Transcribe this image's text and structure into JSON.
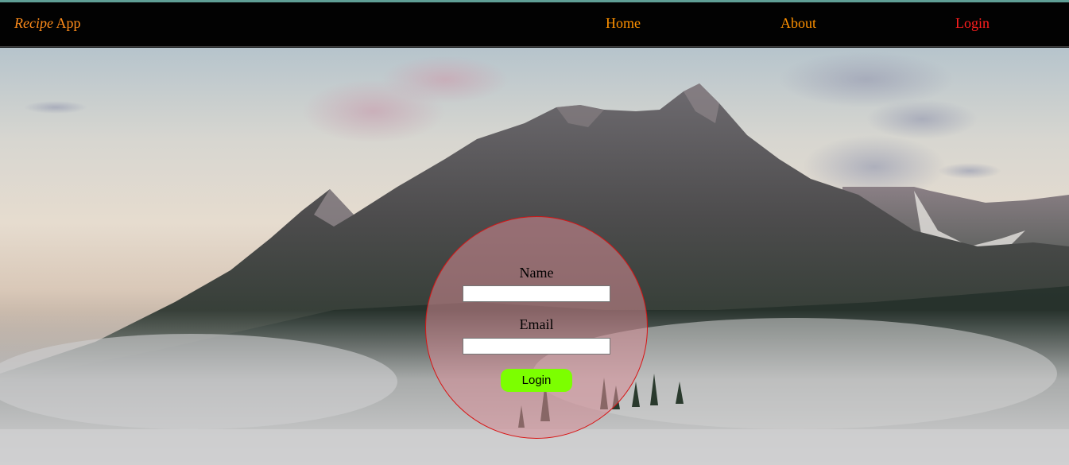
{
  "brand": {
    "italic": "Recipe",
    "rest": " App"
  },
  "nav": {
    "home": "Home",
    "about": "About",
    "login": "Login"
  },
  "form": {
    "name_label": "Name",
    "name_value": "",
    "email_label": "Email",
    "email_value": "",
    "submit_label": "Login"
  },
  "colors": {
    "nav_bg": "#020202",
    "nav_link": "#ff9100",
    "nav_active": "#ff1e1e",
    "button": "#7cff00",
    "circle_border": "#d81414"
  }
}
